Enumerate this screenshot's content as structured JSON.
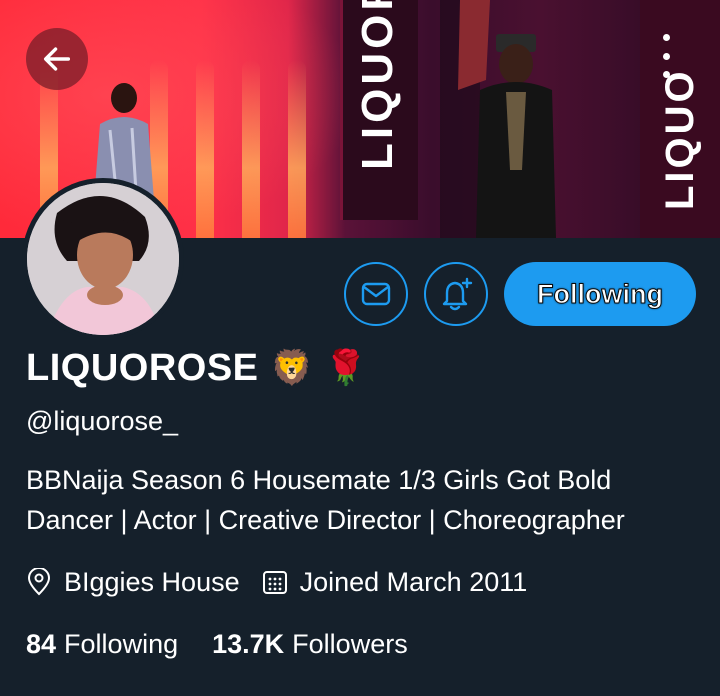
{
  "header": {
    "banner_signs": [
      "LIQUOR",
      "LIQUO"
    ]
  },
  "icons": {
    "back": "arrow-left-icon",
    "more": "vertical-dots-icon",
    "message": "envelope-icon",
    "notify": "bell-plus-icon",
    "location": "location-pin-icon",
    "calendar": "calendar-icon"
  },
  "profile": {
    "display_name": "LIQUOROSE",
    "emoji": [
      "🦁",
      "🌹"
    ],
    "handle": "@liquorose_",
    "bio_line1": "BBNaija Season 6 Housemate 1/3 Girls Got Bold",
    "bio_line2": "Dancer | Actor | Creative Director | Choreographer",
    "location": "BIggies House",
    "joined": "Joined March 2011",
    "following_count": "84",
    "following_label": "Following",
    "followers_count": "13.7K",
    "followers_label": "Followers"
  },
  "actions": {
    "follow_state_label": "Following"
  },
  "colors": {
    "background": "#15202b",
    "accent": "#1d9bf0",
    "text": "#ffffff"
  }
}
